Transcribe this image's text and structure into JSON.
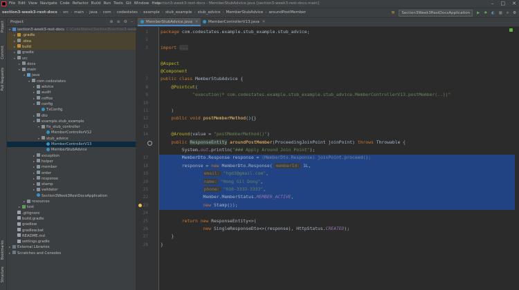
{
  "menubar": {
    "items": [
      "File",
      "Edit",
      "View",
      "Navigate",
      "Code",
      "Refactor",
      "Build",
      "Run",
      "Tools",
      "Git",
      "Window",
      "Help"
    ],
    "window_title": "section3-week3-rest-docs - MemberStubAdvice.java [section3-week3-rest-docs.main]"
  },
  "navbar": {
    "crumbs": [
      "section3-week3-rest-docs",
      "src",
      "main",
      "java",
      "com",
      "codestates",
      "example",
      "stub_example",
      "stub_advice",
      "MemberStubAdvice",
      "aroundPostMember"
    ],
    "run_config": "Section3Week3RestDocsApplication"
  },
  "leftstrip": {
    "tabs": [
      "Project",
      "Commit",
      "Pull Requests",
      "Bookmarks",
      "Structure"
    ]
  },
  "project": {
    "title": "Project",
    "tree": [
      {
        "label": "section3-week3-rest-docs",
        "hint": "C:\\CodeStates\\Section3\\section3-week3-rest-docs",
        "depth": 0,
        "arrow": "▾",
        "icon": "folder-blue"
      },
      {
        "label": ".gradle",
        "depth": 1,
        "arrow": "▸",
        "icon": "folder-orange",
        "style": "excl"
      },
      {
        "label": ".idea",
        "depth": 1,
        "arrow": "▸",
        "icon": "folder",
        "style": "excl"
      },
      {
        "label": "build",
        "depth": 1,
        "arrow": "▸",
        "icon": "folder-orange",
        "style": "excl"
      },
      {
        "label": "gradle",
        "depth": 1,
        "arrow": "▸",
        "icon": "folder"
      },
      {
        "label": "src",
        "depth": 1,
        "arrow": "▾",
        "icon": "folder"
      },
      {
        "label": "docs",
        "depth": 2,
        "arrow": "▸",
        "icon": "folder"
      },
      {
        "label": "main",
        "depth": 2,
        "arrow": "▾",
        "icon": "folder"
      },
      {
        "label": "java",
        "depth": 3,
        "arrow": "▾",
        "icon": "folder-src"
      },
      {
        "label": "com.codestates",
        "depth": 4,
        "arrow": "▾",
        "icon": "folder"
      },
      {
        "label": "advice",
        "depth": 5,
        "arrow": "▸",
        "icon": "folder"
      },
      {
        "label": "audit",
        "depth": 5,
        "arrow": "▸",
        "icon": "folder"
      },
      {
        "label": "coffee",
        "depth": 5,
        "arrow": "▸",
        "icon": "folder"
      },
      {
        "label": "config",
        "depth": 5,
        "arrow": "▾",
        "icon": "folder"
      },
      {
        "label": "TxConfig",
        "depth": 6,
        "arrow": "",
        "icon": "class"
      },
      {
        "label": "dto",
        "depth": 5,
        "arrow": "▸",
        "icon": "folder"
      },
      {
        "label": "example.stub_example",
        "depth": 5,
        "arrow": "▾",
        "icon": "folder"
      },
      {
        "label": "fix_stub_controller",
        "depth": 6,
        "arrow": "▾",
        "icon": "folder"
      },
      {
        "label": "MemberControllerV12",
        "depth": 7,
        "arrow": "",
        "icon": "class"
      },
      {
        "label": "stub_advice",
        "depth": 6,
        "arrow": "▾",
        "icon": "folder"
      },
      {
        "label": "MemberControllerV13",
        "depth": 7,
        "arrow": "",
        "icon": "class",
        "style": "sel"
      },
      {
        "label": "MemberStubAdvice",
        "depth": 7,
        "arrow": "",
        "icon": "class"
      },
      {
        "label": "exception",
        "depth": 5,
        "arrow": "▸",
        "icon": "folder"
      },
      {
        "label": "helper",
        "depth": 5,
        "arrow": "▸",
        "icon": "folder"
      },
      {
        "label": "member",
        "depth": 5,
        "arrow": "▸",
        "icon": "folder"
      },
      {
        "label": "order",
        "depth": 5,
        "arrow": "▸",
        "icon": "folder"
      },
      {
        "label": "response",
        "depth": 5,
        "arrow": "▸",
        "icon": "folder"
      },
      {
        "label": "stamp",
        "depth": 5,
        "arrow": "▸",
        "icon": "folder"
      },
      {
        "label": "validator",
        "depth": 5,
        "arrow": "▸",
        "icon": "folder"
      },
      {
        "label": "Section3Week3RestDocsApplication",
        "depth": 5,
        "arrow": "",
        "icon": "class"
      },
      {
        "label": "resources",
        "depth": 3,
        "arrow": "▸",
        "icon": "folder"
      },
      {
        "label": "test",
        "depth": 2,
        "arrow": "▸",
        "icon": "folder-green"
      },
      {
        "label": ".gitignore",
        "depth": 1,
        "arrow": "",
        "icon": "file"
      },
      {
        "label": "build.gradle",
        "depth": 1,
        "arrow": "",
        "icon": "file"
      },
      {
        "label": "gradlew",
        "depth": 1,
        "arrow": "",
        "icon": "file"
      },
      {
        "label": "gradlew.bat",
        "depth": 1,
        "arrow": "",
        "icon": "file"
      },
      {
        "label": "README.md",
        "depth": 1,
        "arrow": "",
        "icon": "file"
      },
      {
        "label": "settings.gradle",
        "depth": 1,
        "arrow": "",
        "icon": "file"
      },
      {
        "label": "External Libraries",
        "depth": 0,
        "arrow": "▸",
        "icon": "lib"
      },
      {
        "label": "Scratches and Consoles",
        "depth": 0,
        "arrow": "▸",
        "icon": "lib"
      }
    ]
  },
  "tabs": [
    {
      "label": "MemberStubAdvice.java",
      "active": true
    },
    {
      "label": "MemberControllerV13.java",
      "active": false
    }
  ],
  "editor": {
    "line_numbers": [
      "1",
      "2",
      "3",
      "",
      "",
      "",
      "7",
      "8",
      "9",
      "10",
      "11",
      "12",
      "13",
      "14",
      "",
      "",
      "17",
      "18",
      "19",
      "20",
      "21",
      "22",
      "23",
      "24",
      "25",
      "26",
      "27",
      "28",
      "29",
      "30",
      "31",
      "32",
      "33",
      "34",
      "35",
      "36",
      "37",
      "38",
      "39"
    ],
    "lines": [
      {
        "parts": [
          [
            "kw",
            "package "
          ],
          [
            "",
            "com.codestates.example.stub_example.stub_advice;"
          ]
        ]
      },
      {
        "parts": []
      },
      {
        "parts": [
          [
            "kw",
            "import "
          ],
          [
            "hint",
            "..."
          ]
        ]
      },
      {
        "parts": []
      },
      {
        "parts": [
          [
            "an",
            "@Aspect"
          ]
        ]
      },
      {
        "parts": [
          [
            "an",
            "@Component"
          ]
        ]
      },
      {
        "parts": [
          [
            "kw",
            "public class "
          ],
          [
            "",
            "MemberStubAdvice {"
          ]
        ]
      },
      {
        "parts": [
          [
            "",
            "    "
          ],
          [
            "an",
            "@Pointcut"
          ],
          [
            "",
            "("
          ]
        ]
      },
      {
        "parts": [
          [
            "",
            "            "
          ],
          [
            "str",
            "\"execution(* com.codestates.example.stub_example.stub_advice.MemberControllerV13.postMember(..))\""
          ]
        ]
      },
      {
        "parts": []
      },
      {
        "parts": [
          [
            "",
            "    )"
          ]
        ]
      },
      {
        "parts": [
          [
            "",
            "    "
          ],
          [
            "kw",
            "public void "
          ],
          [
            "fn",
            "postMemberMethod"
          ],
          [
            "",
            "(){}"
          ]
        ]
      },
      {
        "parts": []
      },
      {
        "parts": [
          [
            "",
            "    "
          ],
          [
            "an",
            "@Around"
          ],
          [
            "",
            "(value = "
          ],
          [
            "str",
            "\"postMemberMethod()\""
          ],
          [
            "",
            ")"
          ]
        ]
      },
      {
        "parts": [
          [
            "",
            "    "
          ],
          [
            "kw",
            "public "
          ],
          [
            "hlbg",
            "ResponseEntity"
          ],
          [
            "",
            " "
          ],
          [
            "fn",
            "aroundPostMember"
          ],
          [
            "",
            "(ProceedingJoinPoint joinPoint) "
          ],
          [
            "kw",
            "throws "
          ],
          [
            "",
            "Throwable {"
          ]
        ]
      },
      {
        "parts": [
          [
            "",
            "        System."
          ],
          [
            "fld",
            "out"
          ],
          [
            "",
            ".println("
          ],
          [
            "str",
            "\"### Apply Around Join Point\""
          ],
          [
            "",
            ");"
          ]
        ]
      },
      {
        "parts": [
          [
            "",
            "        MemberDto.Response response = "
          ],
          [
            "dimc",
            "(MemberDto.Response) joinPoint.proceed();"
          ]
        ]
      },
      {
        "parts": [
          [
            "",
            "        response = "
          ],
          [
            "kw",
            "new "
          ],
          [
            "",
            "MemberDto.Response( "
          ],
          [
            "hint",
            "memberId:"
          ],
          [
            "",
            " 1L,"
          ]
        ]
      },
      {
        "parts": [
          [
            "",
            "                "
          ],
          [
            "hint",
            "email:"
          ],
          [
            "",
            " "
          ],
          [
            "str",
            "\"hgd3@gmail.com\""
          ],
          [
            "",
            ","
          ]
        ]
      },
      {
        "parts": [
          [
            "",
            "                "
          ],
          [
            "hint",
            "name:"
          ],
          [
            "",
            " "
          ],
          [
            "str",
            "\"Hong Gil Dong\""
          ],
          [
            "",
            ","
          ]
        ]
      },
      {
        "parts": [
          [
            "",
            "                "
          ],
          [
            "hint",
            "phone:"
          ],
          [
            "",
            " "
          ],
          [
            "str",
            "\"010-3333-3333\""
          ],
          [
            "",
            ","
          ]
        ]
      },
      {
        "parts": [
          [
            "",
            "                Member.MemberStatus."
          ],
          [
            "fld",
            "MEMBER_ACTIVE"
          ],
          [
            "",
            ","
          ]
        ]
      },
      {
        "parts": [
          [
            "",
            "                "
          ],
          [
            "kw",
            "new "
          ],
          [
            "",
            "Stamp());"
          ]
        ]
      },
      {
        "parts": []
      },
      {
        "parts": [
          [
            "",
            "        "
          ],
          [
            "kw",
            "return new "
          ],
          [
            "",
            "ResponseEntity<>("
          ]
        ]
      },
      {
        "parts": [
          [
            "",
            "                "
          ],
          [
            "kw",
            "new "
          ],
          [
            "",
            "SingleResponseDto<>(response), HttpStatus."
          ],
          [
            "fld",
            "CREATED"
          ],
          [
            "",
            ");"
          ]
        ]
      },
      {
        "parts": [
          [
            "",
            "    }"
          ]
        ]
      },
      {
        "parts": [
          [
            "",
            "}"
          ]
        ]
      }
    ]
  },
  "colors": {
    "accent": "#4a88c7",
    "selection": "#214283",
    "background": "#2b2b2b",
    "panel": "#3c3f41"
  }
}
